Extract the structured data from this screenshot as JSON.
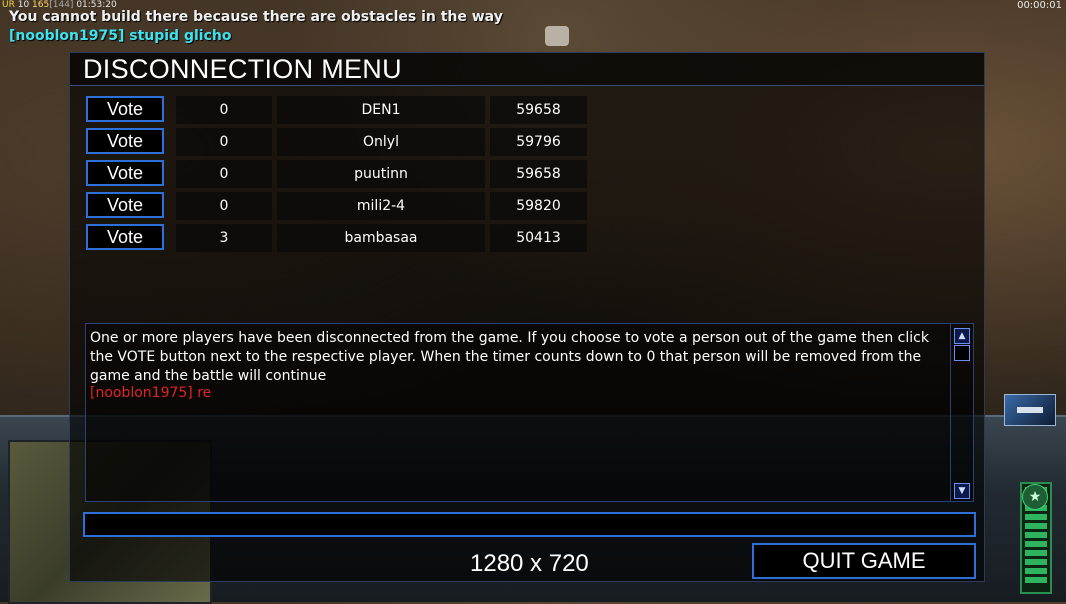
{
  "hud": {
    "stats_ur": "UR",
    "stats_level": "10",
    "stats_fps": "165",
    "stats_bracket": "[144]",
    "stats_clock": "01:53:20",
    "game_timer": "00:00:01",
    "system_message": "You cannot build there because there are obstacles in the way",
    "chat_message": "[nooblon1975] stupid glicho"
  },
  "dialog": {
    "title": "DISCONNECTION MENU",
    "vote_label": "Vote",
    "players": [
      {
        "votes": "0",
        "name": "DEN1",
        "ping": "59658"
      },
      {
        "votes": "0",
        "name": "Onlyl",
        "ping": "59796"
      },
      {
        "votes": "0",
        "name": "puutinn",
        "ping": "59658"
      },
      {
        "votes": "0",
        "name": "mili2-4",
        "ping": "59820"
      },
      {
        "votes": "3",
        "name": "bambasaa",
        "ping": "50413"
      }
    ],
    "info_text": "One or more players have been disconnected from the game. If you choose to vote a person out of the game then click the VOTE button next to the respective player. When the timer counts down to 0 that person will be removed from the game and the battle will continue",
    "chat_line": "[nooblon1975] re",
    "chat_input_value": "",
    "resolution_label": "1280 x 720",
    "quit_label": "QUIT GAME"
  },
  "colors": {
    "accent_border": "#2f6fd8",
    "chat_cyan": "#3ee3f0",
    "chat_red": "#e02424"
  }
}
